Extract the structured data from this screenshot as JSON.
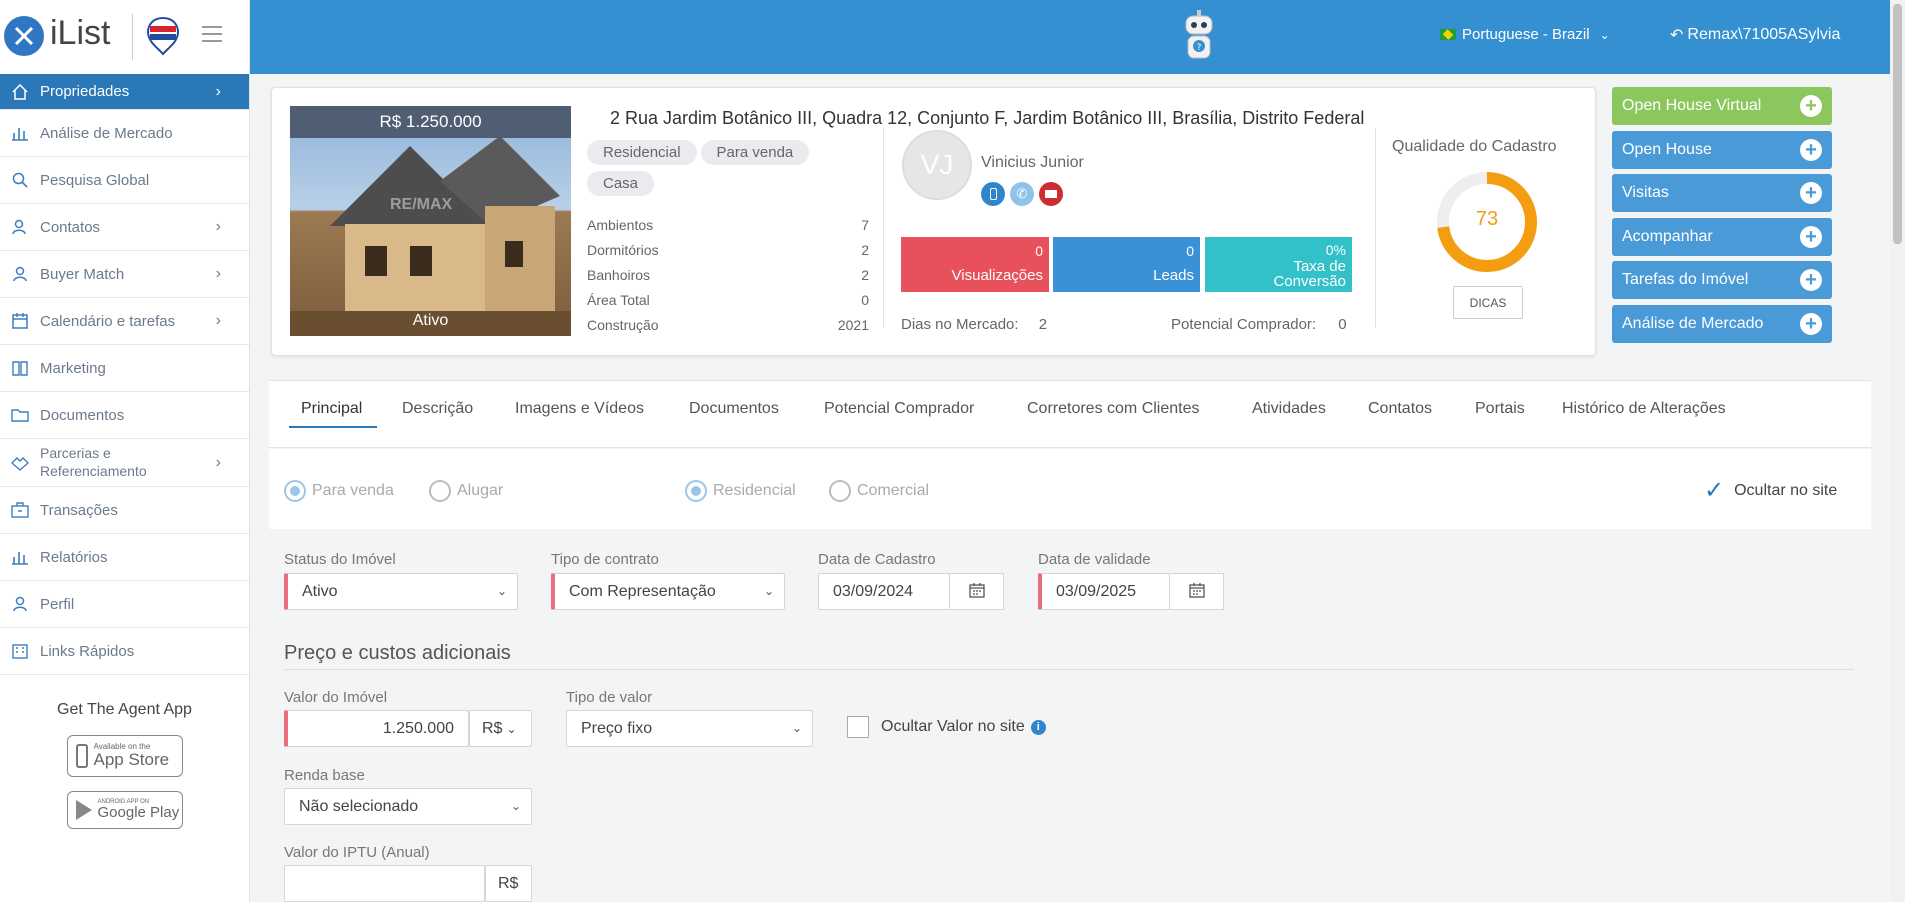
{
  "brand": {
    "name": "iList"
  },
  "header": {
    "language": "Portuguese - Brazil",
    "user": "Remax\\71005ASylvia"
  },
  "sidebar": {
    "items": [
      {
        "label": "Propriedades",
        "icon": "home-icon",
        "has_arrow": true
      },
      {
        "label": "Análise de Mercado",
        "icon": "bar-chart-icon",
        "has_arrow": false
      },
      {
        "label": "Pesquisa Global",
        "icon": "search-icon",
        "has_arrow": false
      },
      {
        "label": "Contatos",
        "icon": "contacts-icon",
        "has_arrow": true
      },
      {
        "label": "Buyer Match",
        "icon": "user-icon",
        "has_arrow": true
      },
      {
        "label": "Calendário e tarefas",
        "icon": "calendar-icon",
        "has_arrow": true
      },
      {
        "label": "Marketing",
        "icon": "book-icon",
        "has_arrow": false
      },
      {
        "label": "Documentos",
        "icon": "folder-icon",
        "has_arrow": false
      },
      {
        "label_line1": "Parcerias e",
        "label_line2": "Referenciamento",
        "icon": "handshake-icon",
        "has_arrow": true
      },
      {
        "label": "Transações",
        "icon": "briefcase-icon",
        "has_arrow": false
      },
      {
        "label": "Relatórios",
        "icon": "report-icon",
        "has_arrow": false
      },
      {
        "label": "Perfil",
        "icon": "user-icon",
        "has_arrow": false
      },
      {
        "label": "Links Rápidos",
        "icon": "building-icon",
        "has_arrow": false
      }
    ],
    "agent_app_title": "Get The Agent App",
    "app_store_small": "Available on the",
    "app_store": "App Store",
    "google_play_small": "ANDROID APP ON",
    "google_play": "Google Play"
  },
  "property": {
    "price": "R$ 1.250.000",
    "status_overlay": "Ativo",
    "watermark": "RE/MAX",
    "address": "2 Rua Jardim Botânico III, Quadra 12, Conjunto F, Jardim Botânico III, Brasília, Distrito Federal",
    "tags": [
      "Residencial",
      "Para venda",
      "Casa"
    ],
    "details": [
      {
        "label": "Ambientos",
        "value": "7"
      },
      {
        "label": "Dormitórios",
        "value": "2"
      },
      {
        "label": "Banhoiros",
        "value": "2"
      },
      {
        "label": "Área Total",
        "value": "0"
      },
      {
        "label": "Construção",
        "value": "2021"
      }
    ],
    "agent_initials": "VJ",
    "agent_name": "Vinicius Junior",
    "stats": [
      {
        "value": "0",
        "label": "Visualizações",
        "color": "#e8505b"
      },
      {
        "value": "0",
        "label": "Leads",
        "color": "#3a91d6"
      },
      {
        "value": "0%",
        "label_line1": "Taxa de",
        "label_line2": "Conversão",
        "color": "#32c1c9"
      }
    ],
    "days_label": "Dias no Mercado:",
    "days_value": "2",
    "buyer_label": "Potencial Comprador:",
    "buyer_value": "0",
    "quality_title": "Qualidade do Cadastro",
    "quality_score": "73",
    "quality_fraction": 0.73,
    "tips_button": "DICAS"
  },
  "actions": [
    {
      "label": "Open House Virtual",
      "color": "#8cc75e"
    },
    {
      "label": "Open House",
      "color": "#4a9ad8"
    },
    {
      "label": "Visitas",
      "color": "#4a9ad8"
    },
    {
      "label": "Acompanhar",
      "color": "#4a9ad8"
    },
    {
      "label": "Tarefas do Imóvel",
      "color": "#4a9ad8"
    },
    {
      "label": "Análise de Mercado",
      "color": "#4a9ad8"
    }
  ],
  "tabs": [
    "Principal",
    "Descrição",
    "Imagens e Vídeos",
    "Documentos",
    "Potencial Comprador",
    "Corretores com Clientes",
    "Atividades",
    "Contatos",
    "Portais",
    "Histórico de Alterações"
  ],
  "form": {
    "radio_sale": "Para venda",
    "radio_rent": "Alugar",
    "radio_residential": "Residencial",
    "radio_commercial": "Comercial",
    "hide_on_site": "Ocultar no site",
    "status_label": "Status do Imóvel",
    "status_value": "Ativo",
    "contract_label": "Tipo de contrato",
    "contract_value": "Com Representação",
    "reg_date_label": "Data de Cadastro",
    "reg_date_value": "03/09/2024",
    "valid_date_label": "Data de validade",
    "valid_date_value": "03/09/2025",
    "section_price": "Preço e custos adicionais",
    "value_label": "Valor do Imóvel",
    "value_value": "1.250.000",
    "currency": "R$",
    "value_type_label": "Tipo de valor",
    "value_type_value": "Preço fixo",
    "hide_value": "Ocultar Valor no site",
    "income_label": "Renda base",
    "income_value": "Não selecionado",
    "iptu_label": "Valor do IPTU (Anual)",
    "iptu_currency": "R$"
  }
}
